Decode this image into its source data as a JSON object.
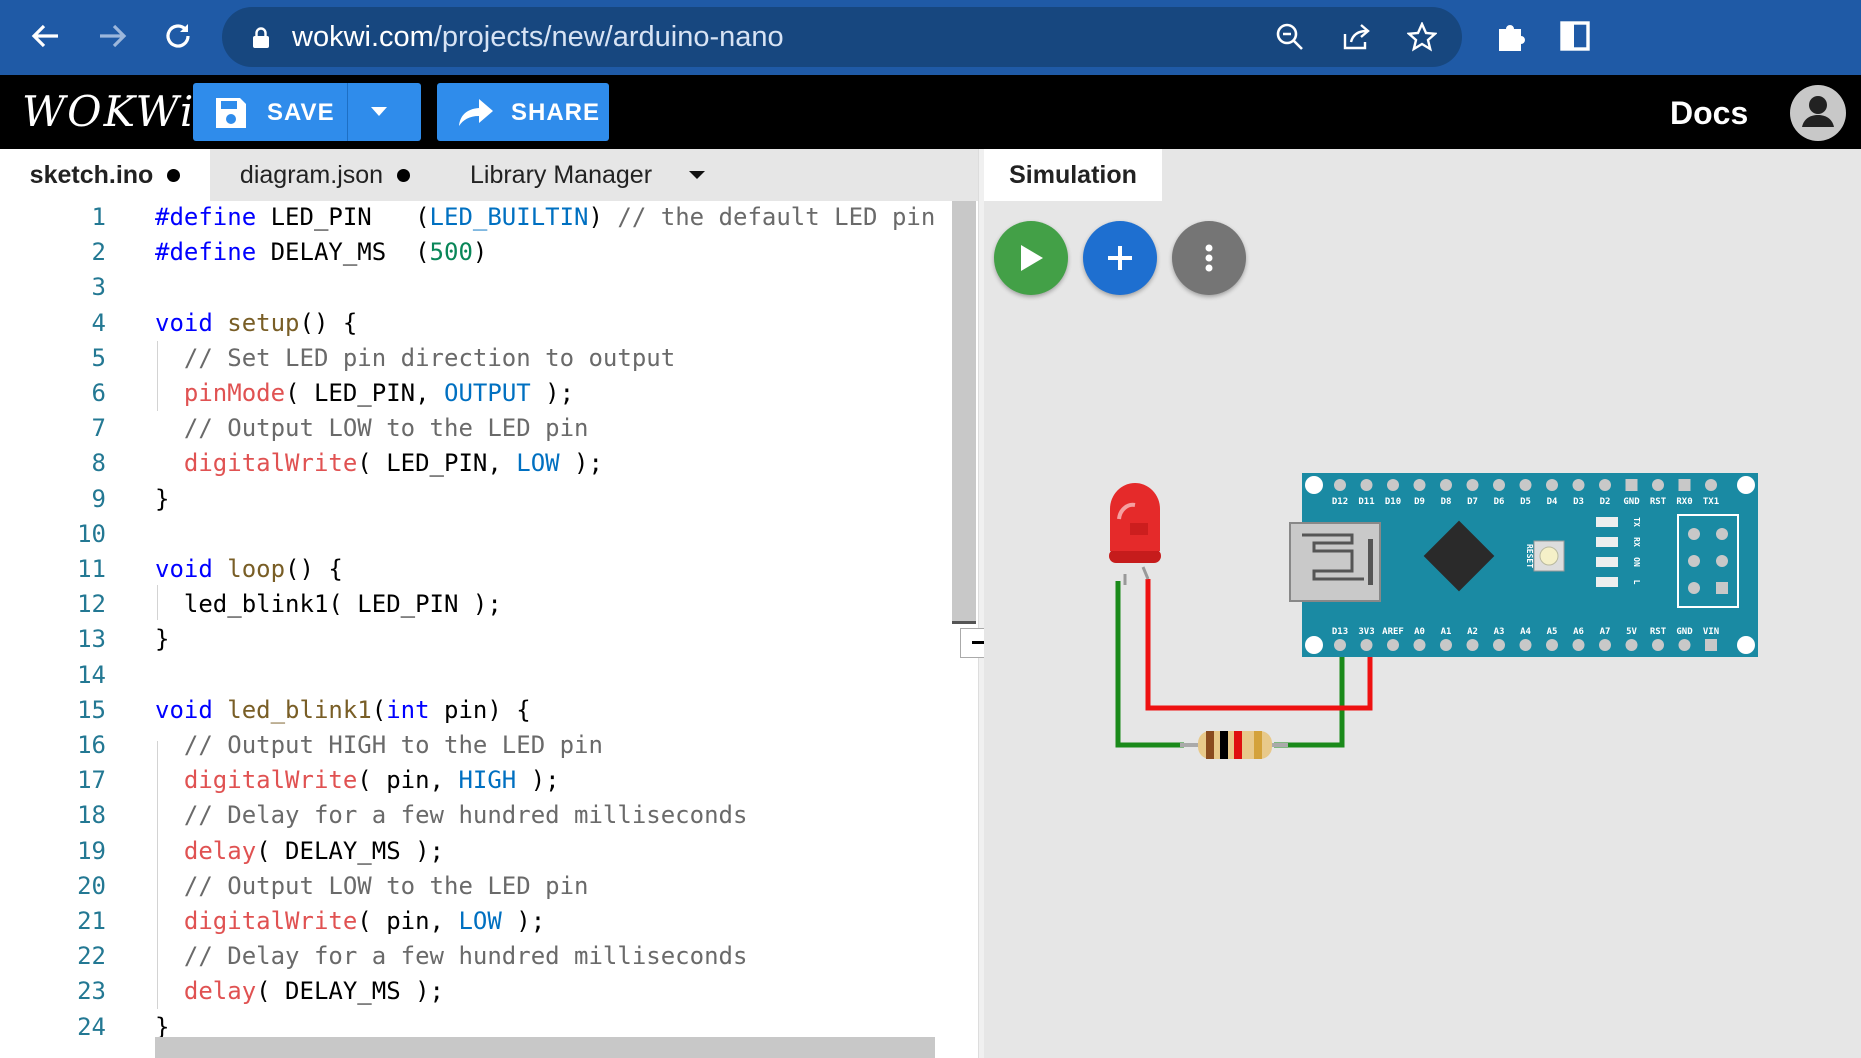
{
  "browser": {
    "url_domain": "wokwi.com",
    "url_path": "/projects/new/arduino-nano"
  },
  "app": {
    "logo": "WOKWi",
    "save_label": "SAVE",
    "share_label": "SHARE",
    "docs_label": "Docs"
  },
  "editor": {
    "tabs": [
      {
        "label": "sketch.ino",
        "modified": true,
        "active": true
      },
      {
        "label": "diagram.json",
        "modified": true,
        "active": false
      },
      {
        "label": "Library Manager",
        "active": false
      }
    ],
    "line_numbers": [
      "1",
      "2",
      "3",
      "4",
      "5",
      "6",
      "7",
      "8",
      "9",
      "10",
      "11",
      "12",
      "13",
      "14",
      "15",
      "16",
      "17",
      "18",
      "19",
      "20",
      "21",
      "22",
      "23",
      "24"
    ],
    "code": [
      "#define LED_PIN   (LED_BUILTIN) // the default LED pin",
      "#define DELAY_MS  (500)",
      "",
      "void setup() {",
      "  // Set LED pin direction to output",
      "  pinMode( LED_PIN, OUTPUT );",
      "  // Output LOW to the LED pin",
      "  digitalWrite( LED_PIN, LOW );",
      "}",
      "",
      "void loop() {",
      "  led_blink1( LED_PIN );",
      "}",
      "",
      "void led_blink1(int pin) {",
      "  // Output HIGH to the LED pin",
      "  digitalWrite( pin, HIGH );",
      "  // Delay for a few hundred milliseconds",
      "  delay( DELAY_MS );",
      "  // Output LOW to the LED pin",
      "  digitalWrite( pin, LOW );",
      "  // Delay for a few hundred milliseconds",
      "  delay( DELAY_MS );",
      "}"
    ]
  },
  "simulation": {
    "tab_label": "Simulation",
    "board": {
      "top_pins": [
        "D12",
        "D11",
        "D10",
        "D9",
        "D8",
        "D7",
        "D6",
        "D5",
        "D4",
        "D3",
        "D2",
        "GND",
        "RST",
        "RX0",
        "TX1"
      ],
      "bottom_pins": [
        "D13",
        "3V3",
        "AREF",
        "A0",
        "A1",
        "A2",
        "A3",
        "A4",
        "A5",
        "A6",
        "A7",
        "5V",
        "RST",
        "GND",
        "VIN"
      ],
      "reset_label": "RESET",
      "led_labels": [
        "TX",
        "RX",
        "ON",
        "L"
      ]
    }
  },
  "colors": {
    "browser_bar": "#1f5aa6",
    "accent_button": "#2f8ceb",
    "play_button": "#43a047",
    "add_button": "#1e6fd0",
    "more_button": "#757575",
    "board": "#1a8aa3"
  }
}
